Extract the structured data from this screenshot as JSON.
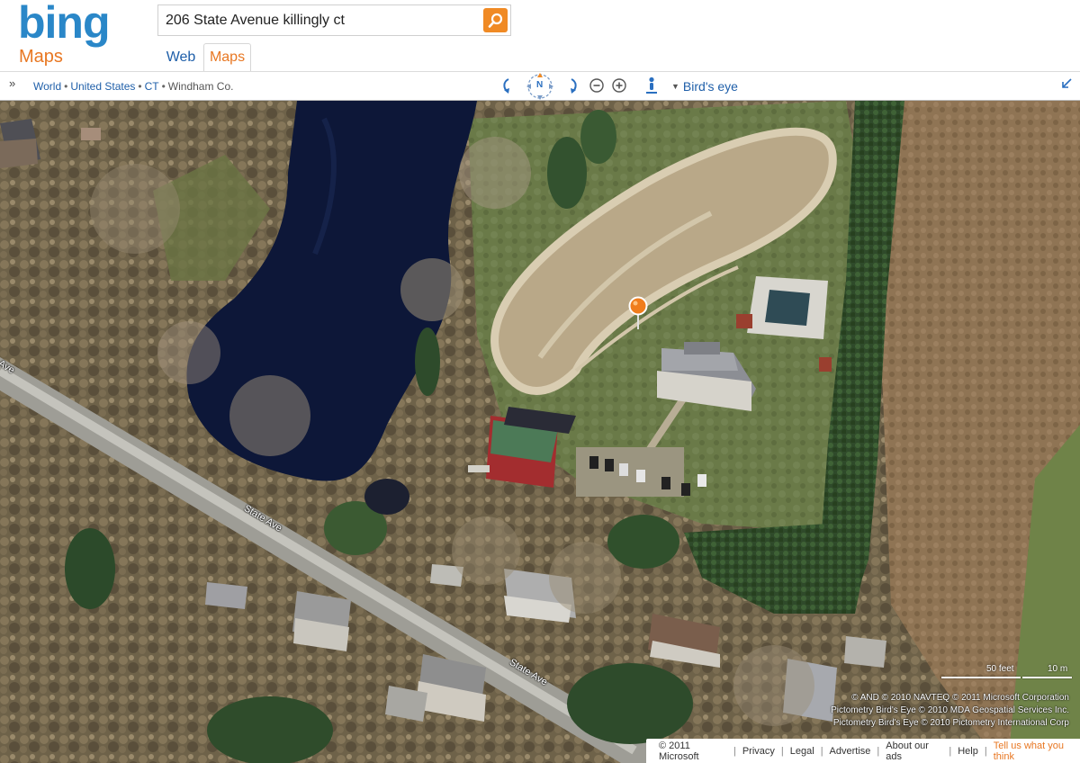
{
  "header": {
    "logo_text": "bing",
    "logo_sub": "Maps",
    "search_value": "206 State Avenue killingly ct",
    "tabs": [
      {
        "label": "Web",
        "active": false
      },
      {
        "label": "Maps",
        "active": true
      }
    ]
  },
  "toolbar": {
    "breadcrumb": [
      "World",
      "United States",
      "CT",
      "Windham Co."
    ],
    "compass_label": "N",
    "view_mode": "Bird's eye"
  },
  "map": {
    "road_labels": [
      "State Ave",
      "State Ave",
      "Ave"
    ],
    "scale": {
      "feet_label": "50 feet",
      "meters_label": "10 m"
    },
    "attribution": [
      "© AND  © 2010 NAVTEQ  © 2011 Microsoft Corporation",
      "Pictometry Bird's Eye © 2010 MDA Geospatial Services Inc.",
      "Pictometry Bird's Eye © 2010 Pictometry International Corp"
    ]
  },
  "footer": {
    "copyright": "© 2011 Microsoft",
    "links": [
      "Privacy",
      "Legal",
      "Advertise",
      "About our ads",
      "Help"
    ],
    "feedback": "Tell us what you think"
  },
  "colors": {
    "brand_blue": "#2a87c8",
    "accent_orange": "#e87722",
    "link_blue": "#1f5fa9"
  }
}
